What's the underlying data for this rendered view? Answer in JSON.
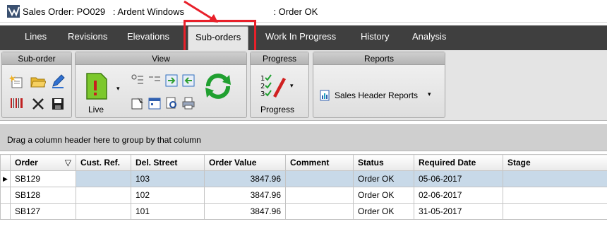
{
  "window": {
    "title": "Sales Order: PO029   : Ardent Windows                                   : Order OK"
  },
  "tabs": [
    {
      "label": "Lines"
    },
    {
      "label": "Revisions"
    },
    {
      "label": "Elevations"
    },
    {
      "label": "Sub-orders",
      "active": true
    },
    {
      "label": "Work In Progress"
    },
    {
      "label": "History"
    },
    {
      "label": "Analysis"
    }
  ],
  "ribbon": {
    "groups": {
      "suborder": {
        "title": "Sub-order"
      },
      "view": {
        "title": "View",
        "live_label": "Live"
      },
      "progress": {
        "title": "Progress",
        "button_label": "Progress"
      },
      "reports": {
        "title": "Reports",
        "button_label": "Sales Header Reports"
      }
    }
  },
  "grid": {
    "group_hint": "Drag a column header here to group by that column",
    "columns": [
      "Order",
      "Cust. Ref.",
      "Del. Street",
      "Order Value",
      "Comment",
      "Status",
      "Required Date",
      "Stage"
    ],
    "rows": [
      {
        "order": "SB129",
        "cust_ref": "",
        "del_street": "103",
        "order_value": "3847.96",
        "comment": "",
        "status": "Order OK",
        "required_date": "05-06-2017",
        "stage": ""
      },
      {
        "order": "SB128",
        "cust_ref": "",
        "del_street": "102",
        "order_value": "3847.96",
        "comment": "",
        "status": "Order OK",
        "required_date": "02-06-2017",
        "stage": ""
      },
      {
        "order": "SB127",
        "cust_ref": "",
        "del_street": "101",
        "order_value": "3847.96",
        "comment": "",
        "status": "Order OK",
        "required_date": "31-05-2017",
        "stage": ""
      }
    ]
  },
  "colors": {
    "tabbar": "#3f3f3f",
    "highlight": "#e8202a",
    "selection": "#c8d9e8"
  }
}
